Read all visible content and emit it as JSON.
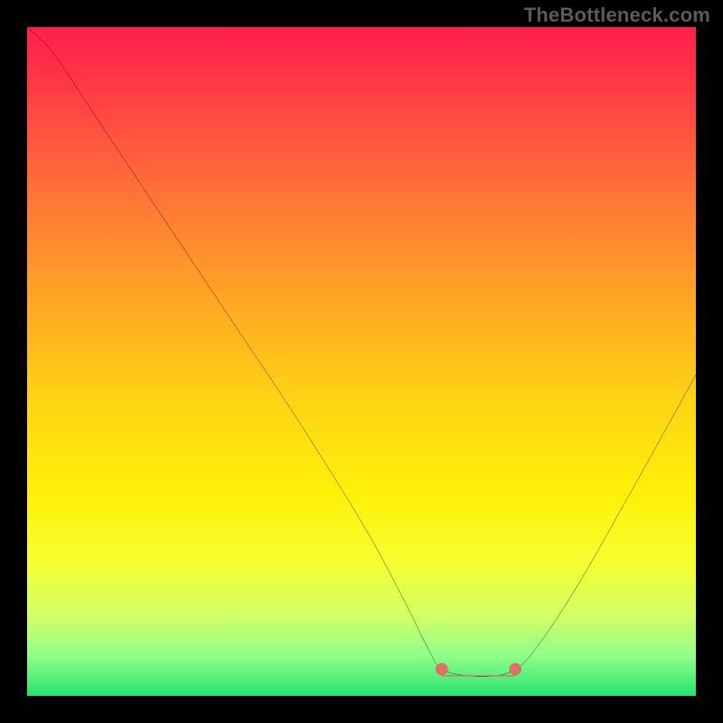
{
  "watermark": "TheBottleneck.com",
  "chart_data": {
    "type": "line",
    "title": "",
    "xlabel": "",
    "ylabel": "",
    "xlim": [
      0,
      100
    ],
    "ylim": [
      0,
      100
    ],
    "grid": false,
    "legend": false,
    "description": "Bottleneck curve over a performance gradient (red=high bottleneck, green=low). The curve dips to a flat minimum near x≈62–73 then rises again.",
    "x": [
      0,
      4,
      10,
      20,
      30,
      40,
      50,
      56,
      60,
      62,
      66,
      70,
      73,
      76,
      82,
      90,
      100
    ],
    "y": [
      100,
      96,
      87,
      72,
      57,
      42,
      26,
      15,
      7,
      4,
      3,
      3,
      4,
      7,
      16,
      30,
      48
    ],
    "trough_markers": {
      "x": [
        62,
        73
      ],
      "y": [
        4,
        4
      ],
      "color": "#e27066"
    },
    "flat_segment": {
      "x_start": 62,
      "x_end": 73,
      "y": 3,
      "color": "#e27066"
    }
  },
  "colors": {
    "curve": "#000000",
    "marker_fill": "#e27066",
    "marker_stroke": "#b85148",
    "background_black": "#000000"
  }
}
